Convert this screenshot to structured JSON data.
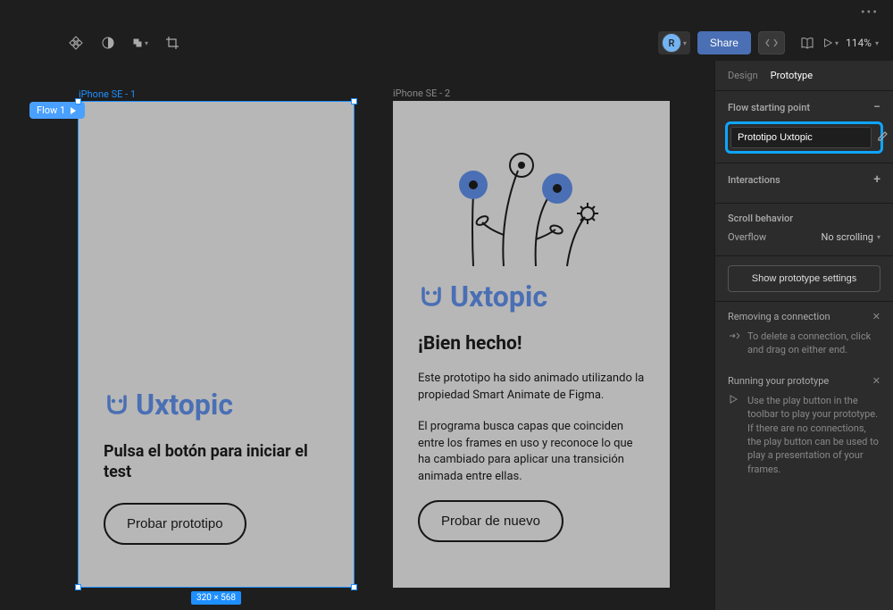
{
  "toolbar": {
    "avatar_letter": "R",
    "share_label": "Share",
    "zoom": "114%"
  },
  "canvas": {
    "frame1": {
      "label": "iPhone SE - 1",
      "flow_badge": "Flow 1",
      "logo": "Uxtopic",
      "text": "Pulsa el botón para iniciar el test",
      "button": "Probar prototipo",
      "dimensions": "320 × 568"
    },
    "frame2": {
      "label": "iPhone SE - 2",
      "logo": "Uxtopic",
      "heading": "¡Bien hecho!",
      "para1": "Este prototipo ha sido animado utilizando la propiedad Smart Animate de Figma.",
      "para2": "El programa busca capas que coinciden entre los frames en uso y reconoce lo que ha cambiado para aplicar una transición animada entre ellas.",
      "button": "Probar de nuevo"
    }
  },
  "panel": {
    "tab_design": "Design",
    "tab_prototype": "Prototype",
    "flow_section": "Flow starting point",
    "flow_name": "Prototipo Uxtopic",
    "interactions": "Interactions",
    "scroll_behavior": "Scroll behavior",
    "overflow_label": "Overflow",
    "overflow_value": "No scrolling",
    "show_settings": "Show prototype settings",
    "tip1_title": "Removing a connection",
    "tip1_body": "To delete a connection, click and drag on either end.",
    "tip2_title": "Running your prototype",
    "tip2_body": "Use the play button in the toolbar to play your prototype. If there are no connections, the play button can be used to play a presentation of your frames."
  }
}
